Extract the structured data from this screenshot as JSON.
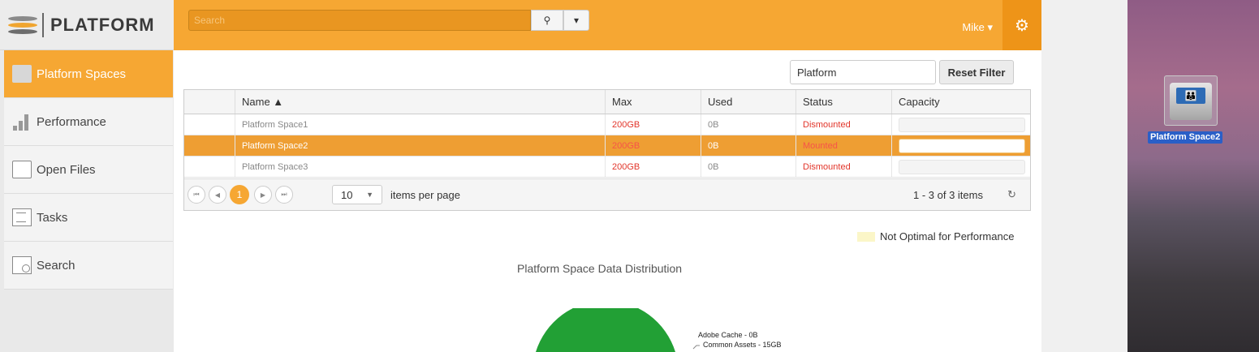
{
  "app": {
    "brand": "PLATFORM"
  },
  "sidebar": {
    "items": [
      {
        "label": "Platform Spaces",
        "icon": "folder-icon",
        "active": true
      },
      {
        "label": "Performance",
        "icon": "bar-chart-icon",
        "active": false
      },
      {
        "label": "Open Files",
        "icon": "file-lock-icon",
        "active": false
      },
      {
        "label": "Tasks",
        "icon": "tasks-icon",
        "active": false
      },
      {
        "label": "Search",
        "icon": "search-doc-icon",
        "active": false
      }
    ]
  },
  "topbar": {
    "search_placeholder": "Search",
    "search_icon": "🔍",
    "dropdown_caret": "▾",
    "user": "Mike ▾",
    "settings_icon": "⚙",
    "accent_color": "#f6a733"
  },
  "filter": {
    "value": "Platform",
    "reset_label": "Reset Filter"
  },
  "grid": {
    "columns": [
      "Name ▲",
      "Max",
      "Used",
      "Status",
      "Capacity"
    ],
    "rows": [
      {
        "name": "Platform Space1",
        "max": "200GB",
        "used": "0B",
        "status": "Dismounted",
        "selected": false
      },
      {
        "name": "Platform Space2",
        "max": "200GB",
        "used": "0B",
        "status": "Mounted",
        "selected": true
      },
      {
        "name": "Platform Space3",
        "max": "200GB",
        "used": "0B",
        "status": "Dismounted",
        "selected": false
      }
    ]
  },
  "pager": {
    "first": "⏮",
    "prev": "◀",
    "current_page": "1",
    "next": "▶",
    "last": "⏭",
    "page_size": "10",
    "page_size_caret": "▼",
    "items_per_page": "items per page",
    "range": "1 - 3 of 3 items",
    "refresh_icon": "↻"
  },
  "legend": {
    "label": "Not Optimal for Performance",
    "color": "#fbf6c8"
  },
  "chart": {
    "title": "Platform Space Data Distribution",
    "labels": [
      "Adobe Cache - 0B",
      "Common Assets - 15GB"
    ]
  },
  "desktop": {
    "drive_label": "Platform Space2",
    "drive_people": "👪"
  }
}
